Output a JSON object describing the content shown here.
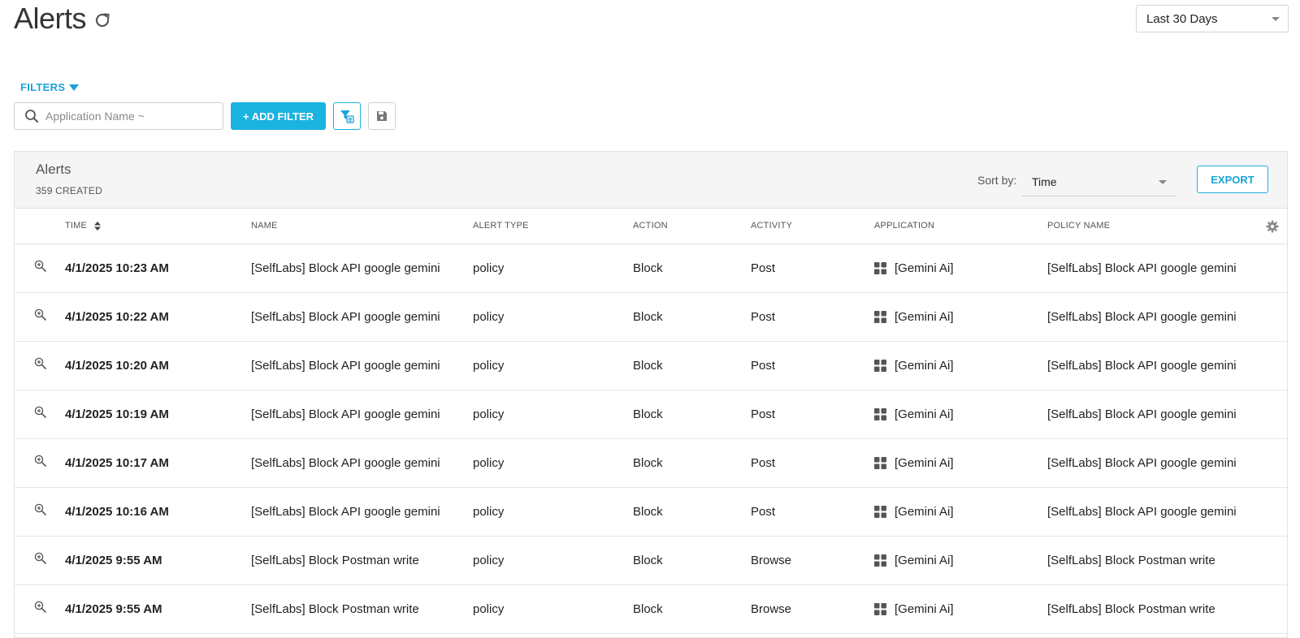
{
  "page": {
    "title": "Alerts",
    "date_range": "Last 30 Days"
  },
  "filters": {
    "toggle_label": "FILTERS",
    "search_placeholder": "Application Name ~",
    "add_filter_label": "+ ADD FILTER"
  },
  "panel": {
    "title": "Alerts",
    "count_label": "359 CREATED",
    "sort_label": "Sort by:",
    "sort_value": "Time",
    "export_label": "EXPORT"
  },
  "table": {
    "columns": [
      "TIME",
      "NAME",
      "ALERT TYPE",
      "ACTION",
      "ACTIVITY",
      "APPLICATION",
      "POLICY NAME"
    ],
    "rows": [
      {
        "time": "4/1/2025 10:23 AM",
        "name": "[SelfLabs] Block API google gemini",
        "alert_type": "policy",
        "action": "Block",
        "activity": "Post",
        "application": "[Gemini Ai]",
        "policy_name": "[SelfLabs] Block API google gemini"
      },
      {
        "time": "4/1/2025 10:22 AM",
        "name": "[SelfLabs] Block API google gemini",
        "alert_type": "policy",
        "action": "Block",
        "activity": "Post",
        "application": "[Gemini Ai]",
        "policy_name": "[SelfLabs] Block API google gemini"
      },
      {
        "time": "4/1/2025 10:20 AM",
        "name": "[SelfLabs] Block API google gemini",
        "alert_type": "policy",
        "action": "Block",
        "activity": "Post",
        "application": "[Gemini Ai]",
        "policy_name": "[SelfLabs] Block API google gemini"
      },
      {
        "time": "4/1/2025 10:19 AM",
        "name": "[SelfLabs] Block API google gemini",
        "alert_type": "policy",
        "action": "Block",
        "activity": "Post",
        "application": "[Gemini Ai]",
        "policy_name": "[SelfLabs] Block API google gemini"
      },
      {
        "time": "4/1/2025 10:17 AM",
        "name": "[SelfLabs] Block API google gemini",
        "alert_type": "policy",
        "action": "Block",
        "activity": "Post",
        "application": "[Gemini Ai]",
        "policy_name": "[SelfLabs] Block API google gemini"
      },
      {
        "time": "4/1/2025 10:16 AM",
        "name": "[SelfLabs] Block API google gemini",
        "alert_type": "policy",
        "action": "Block",
        "activity": "Post",
        "application": "[Gemini Ai]",
        "policy_name": "[SelfLabs] Block API google gemini"
      },
      {
        "time": "4/1/2025 9:55 AM",
        "name": "[SelfLabs] Block Postman write",
        "alert_type": "policy",
        "action": "Block",
        "activity": "Browse",
        "application": "[Gemini Ai]",
        "policy_name": "[SelfLabs] Block Postman write"
      },
      {
        "time": "4/1/2025 9:55 AM",
        "name": "[SelfLabs] Block Postman write",
        "alert_type": "policy",
        "action": "Block",
        "activity": "Browse",
        "application": "[Gemini Ai]",
        "policy_name": "[SelfLabs] Block Postman write"
      }
    ]
  },
  "icons": {
    "refresh": "refresh-icon",
    "search": "search-icon",
    "filter_manage": "filter-list-icon",
    "save": "save-icon",
    "sort": "sort-arrows-icon",
    "settings": "gear-icon",
    "zoom": "zoom-in-icon",
    "app": "grid-app-icon"
  },
  "colors": {
    "accent": "#1bb3e0",
    "accent_text": "#1aa3d8",
    "header_bg": "#f5f5f5"
  }
}
